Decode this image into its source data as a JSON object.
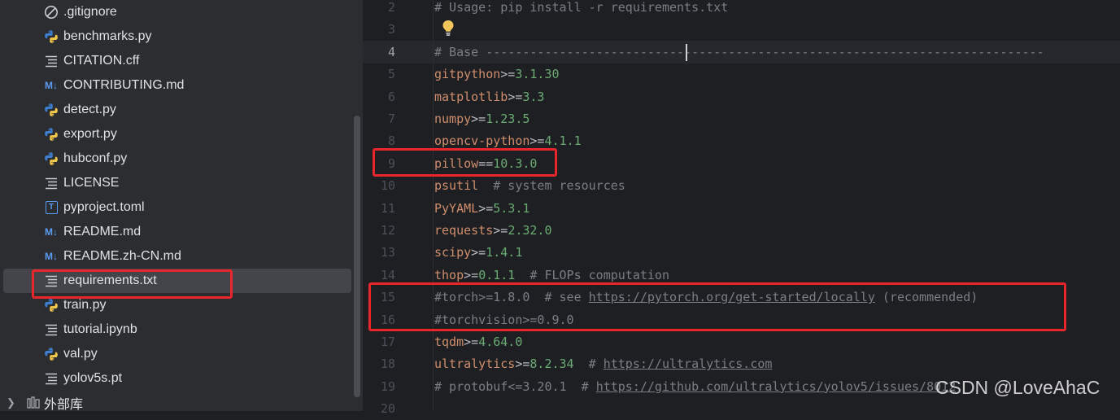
{
  "project_tree": {
    "items": [
      {
        "label": ".gitignore",
        "icon": "ignore-icon"
      },
      {
        "label": "benchmarks.py",
        "icon": "python-icon"
      },
      {
        "label": "CITATION.cff",
        "icon": "text-file-icon"
      },
      {
        "label": "CONTRIBUTING.md",
        "icon": "markdown-icon"
      },
      {
        "label": "detect.py",
        "icon": "python-icon"
      },
      {
        "label": "export.py",
        "icon": "python-icon"
      },
      {
        "label": "hubconf.py",
        "icon": "python-icon"
      },
      {
        "label": "LICENSE",
        "icon": "text-file-icon"
      },
      {
        "label": "pyproject.toml",
        "icon": "toml-icon"
      },
      {
        "label": "README.md",
        "icon": "markdown-icon"
      },
      {
        "label": "README.zh-CN.md",
        "icon": "markdown-icon"
      },
      {
        "label": "requirements.txt",
        "icon": "text-file-icon",
        "selected": true
      },
      {
        "label": "train.py",
        "icon": "python-icon"
      },
      {
        "label": "tutorial.ipynb",
        "icon": "text-file-icon"
      },
      {
        "label": "val.py",
        "icon": "python-icon"
      },
      {
        "label": "yolov5s.pt",
        "icon": "text-file-icon"
      }
    ],
    "external_libraries": "外部库",
    "markdown_badge": "M↓",
    "toml_badge": "T"
  },
  "editor": {
    "lines": [
      {
        "n": "2",
        "text": "# Usage: pip install -r requirements.txt"
      },
      {
        "n": "3",
        "text": ""
      },
      {
        "n": "4",
        "text": "# Base ----------------------------------------------------------------------------"
      },
      {
        "n": "5",
        "pkg": "gitpython",
        "op": ">=",
        "ver": "3.1.30"
      },
      {
        "n": "6",
        "pkg": "matplotlib",
        "op": ">=",
        "ver": "3.3"
      },
      {
        "n": "7",
        "pkg": "numpy",
        "op": ">=",
        "ver": "1.23.5"
      },
      {
        "n": "8",
        "pkg": "opencv-python",
        "op": ">=",
        "ver": "4.1.1"
      },
      {
        "n": "9",
        "pkg": "pillow",
        "op": "==",
        "ver": "10.3.0"
      },
      {
        "n": "10",
        "pkg": "psutil",
        "comment": "  # system resources"
      },
      {
        "n": "11",
        "pkg": "PyYAML",
        "op": ">=",
        "ver": "5.3.1"
      },
      {
        "n": "12",
        "pkg": "requests",
        "op": ">=",
        "ver": "2.32.0"
      },
      {
        "n": "13",
        "pkg": "scipy",
        "op": ">=",
        "ver": "1.4.1"
      },
      {
        "n": "14",
        "pkg": "thop",
        "op": ">=",
        "ver": "0.1.1",
        "comment": "  # FLOPs computation"
      },
      {
        "n": "15",
        "text": "#torch>=1.8.0  # see ",
        "link": "https://pytorch.org/get-started/locally",
        "tail": " (recommended)"
      },
      {
        "n": "16",
        "text": "#torchvision>=0.9.0"
      },
      {
        "n": "17",
        "pkg": "tqdm",
        "op": ">=",
        "ver": "4.64.0"
      },
      {
        "n": "18",
        "pkg": "ultralytics",
        "op": ">=",
        "ver": "8.2.34",
        "comment": "  # ",
        "link": "https://ultralytics.com"
      },
      {
        "n": "19",
        "text": "# protobuf<=3.20.1  # ",
        "link": "https://github.com/ultralytics/yolov5/issues/8012"
      },
      {
        "n": "20",
        "text": ""
      }
    ],
    "current_line": "4"
  },
  "watermark": "CSDN @LoveAhaC",
  "colors": {
    "highlight_box": "#e8262b",
    "package": "#cf8e6d",
    "version": "#6aab73",
    "comment": "#7a7e85"
  }
}
